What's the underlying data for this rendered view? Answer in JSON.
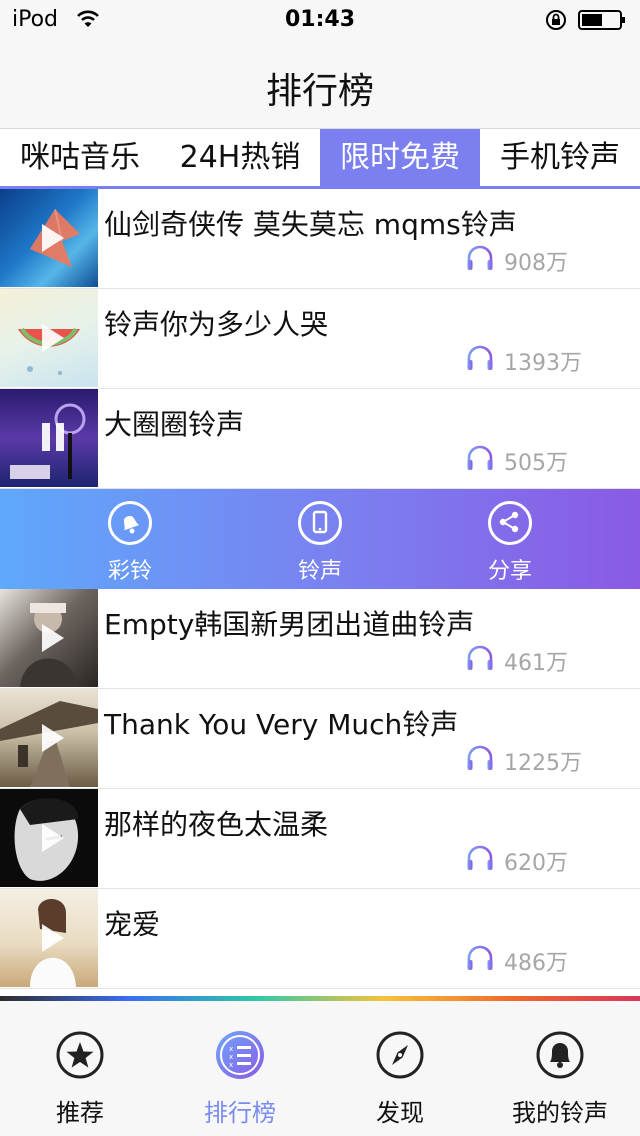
{
  "status_bar": {
    "carrier": "iPod",
    "time": "01:43"
  },
  "nav": {
    "title": "排行榜"
  },
  "tabs": [
    {
      "label": "咪咕音乐",
      "active": false
    },
    {
      "label": "24H热销",
      "active": false
    },
    {
      "label": "限时免费",
      "active": true
    },
    {
      "label": "手机铃声",
      "active": false
    }
  ],
  "songs": [
    {
      "title": "仙剑奇侠传  莫失莫忘 mqms铃声",
      "plays": "908万",
      "state": "play"
    },
    {
      "title": "铃声你为多少人哭",
      "plays": "1393万",
      "state": "play"
    },
    {
      "title": "大圈圈铃声",
      "plays": "505万",
      "state": "pause"
    },
    {
      "title": "Empty韩国新男团出道曲铃声",
      "plays": "461万",
      "state": "play"
    },
    {
      "title": "Thank You Very Much铃声",
      "plays": "1225万",
      "state": "play"
    },
    {
      "title": "那样的夜色太温柔",
      "plays": "620万",
      "state": "play"
    },
    {
      "title": "宠爱",
      "plays": "486万",
      "state": "play"
    }
  ],
  "actions": [
    {
      "label": "彩铃",
      "icon": "bell-icon"
    },
    {
      "label": "铃声",
      "icon": "phone-icon"
    },
    {
      "label": "分享",
      "icon": "share-icon"
    }
  ],
  "tab_bar": [
    {
      "label": "推荐",
      "icon": "star-icon",
      "active": false
    },
    {
      "label": "排行榜",
      "icon": "ranking-list-icon",
      "active": true
    },
    {
      "label": "发现",
      "icon": "compass-icon",
      "active": false
    },
    {
      "label": "我的铃声",
      "icon": "bell-icon",
      "active": false
    }
  ],
  "colors": {
    "accent": "#7b7ff0",
    "accent_light": "#5fa8fb",
    "accent_dark": "#8a5ae4",
    "play_count": "#a6a6a6",
    "tab_active_text": "#7b8cf0"
  }
}
